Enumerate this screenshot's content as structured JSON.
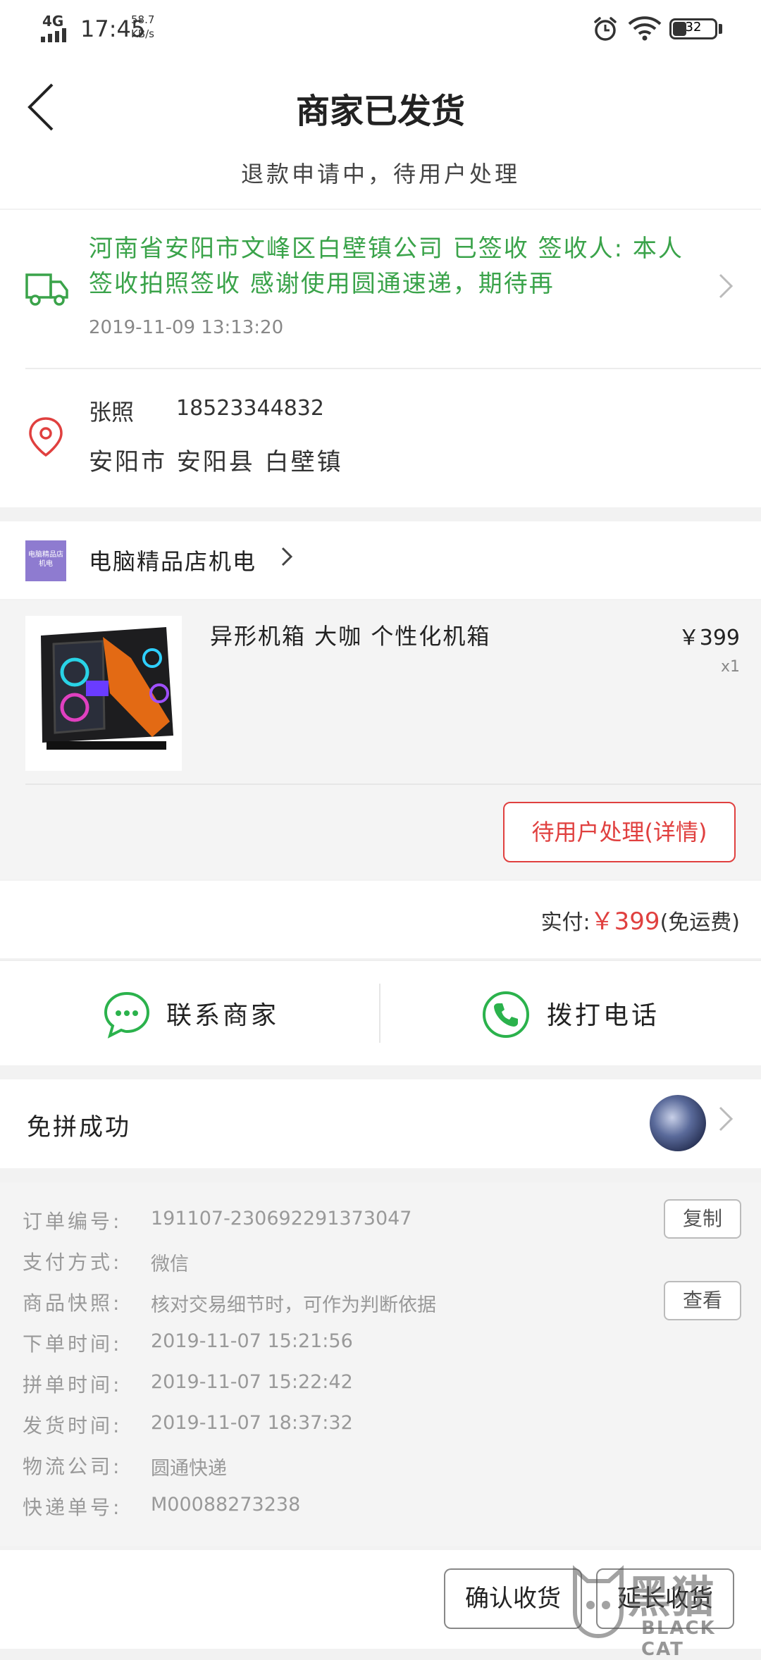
{
  "status_bar": {
    "network": "4G",
    "time": "17:45",
    "speed_value": "58.7",
    "speed_unit": "KB/s",
    "battery": "32",
    "battery_level": 0.32
  },
  "header": {
    "title": "商家已发货",
    "subtitle": "退款申请中，待用户处理"
  },
  "logistics": {
    "latest": "河南省安阳市文峰区白壁镇公司 已签收 签收人: 本人签收拍照签收 感谢使用圆通速递，期待再",
    "time": "2019-11-09  13:13:20"
  },
  "recipient": {
    "name": "张照",
    "phone": "18523344832",
    "address": "安阳市 安阳县 白壁镇"
  },
  "shop": {
    "logo_text": "电脑精品店机电",
    "name": "电脑精品店机电"
  },
  "goods": {
    "title": "异形机箱 大咖 个性化机箱",
    "price": "￥399",
    "qty": "x1",
    "after_sale_label": "待用户处理(详情)"
  },
  "total": {
    "label": "实付:",
    "amount": "￥399",
    "note": "(免运费)"
  },
  "actions": {
    "contact_label": "联系商家",
    "call_label": "拨打电话"
  },
  "group": {
    "status": "免拼成功"
  },
  "order_info": {
    "rows": [
      {
        "label": "订单编号:",
        "value": "191107-230692291373047"
      },
      {
        "label": "支付方式:",
        "value": "微信"
      },
      {
        "label": "商品快照:",
        "value": "核对交易细节时，可作为判断依据"
      },
      {
        "label": "下单时间:",
        "value": "2019-11-07  15:21:56"
      },
      {
        "label": "拼单时间:",
        "value": "2019-11-07  15:22:42"
      },
      {
        "label": "发货时间:",
        "value": "2019-11-07  18:37:32"
      },
      {
        "label": "物流公司:",
        "value": "圆通快递"
      },
      {
        "label": "快递单号:",
        "value": "M00088273238"
      }
    ],
    "copy_label": "复制",
    "view_label": "查看"
  },
  "bottom": {
    "confirm_label": "确认收货",
    "extend_label": "延长收货"
  },
  "watermark": {
    "cn": "黑猫",
    "en": "BLACK CAT"
  },
  "colors": {
    "accent_red": "#e0403f",
    "logistics_green": "#3aa34a",
    "action_green": "#2bb24c"
  }
}
